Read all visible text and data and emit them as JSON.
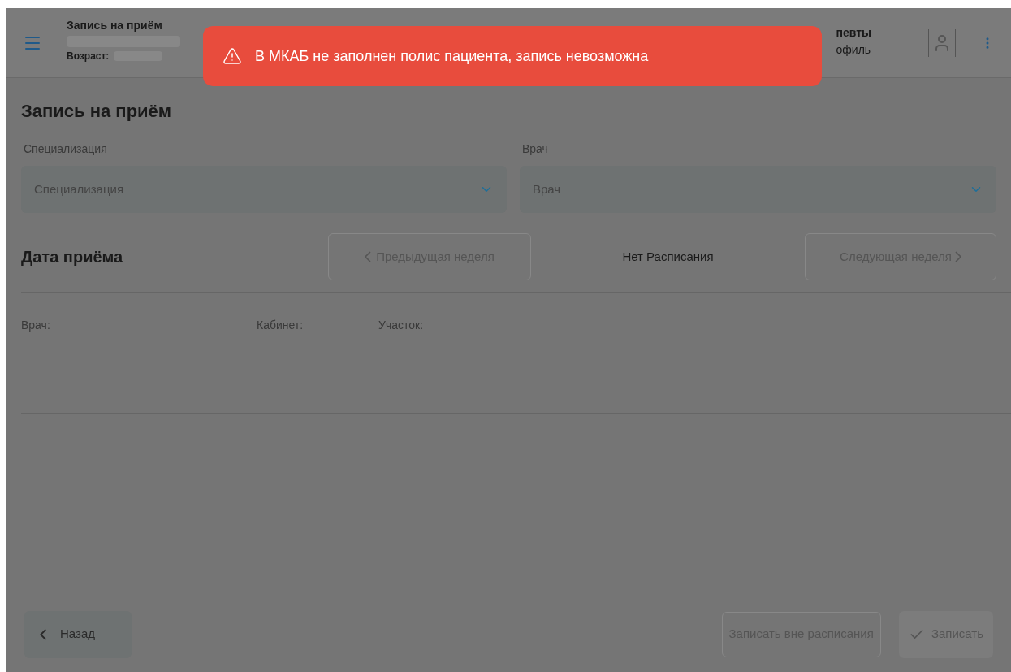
{
  "header": {
    "title": "Запись на приём",
    "age_label": "Возраст:",
    "right_top": "певты",
    "right_bottom": "офиль"
  },
  "toast": {
    "kind": "error",
    "message": "В МКАБ не заполнен полис пациента, запись невозможна"
  },
  "page_title": "Запись на приём",
  "fields": [
    {
      "label": "Специализация",
      "placeholder": "Специализация"
    },
    {
      "label": "Врач",
      "placeholder": "Врач"
    }
  ],
  "schedule": {
    "title": "Дата приёма",
    "prev_button": "Предыдущая неделя",
    "status": "Нет Расписания",
    "next_button": "Следующая неделя"
  },
  "info": [
    "Врач:",
    "Кабинет:",
    "Участок:"
  ],
  "footer": {
    "back_button": "Назад",
    "outside_button": "Записать вне расписания",
    "submit_button": "Записать"
  }
}
